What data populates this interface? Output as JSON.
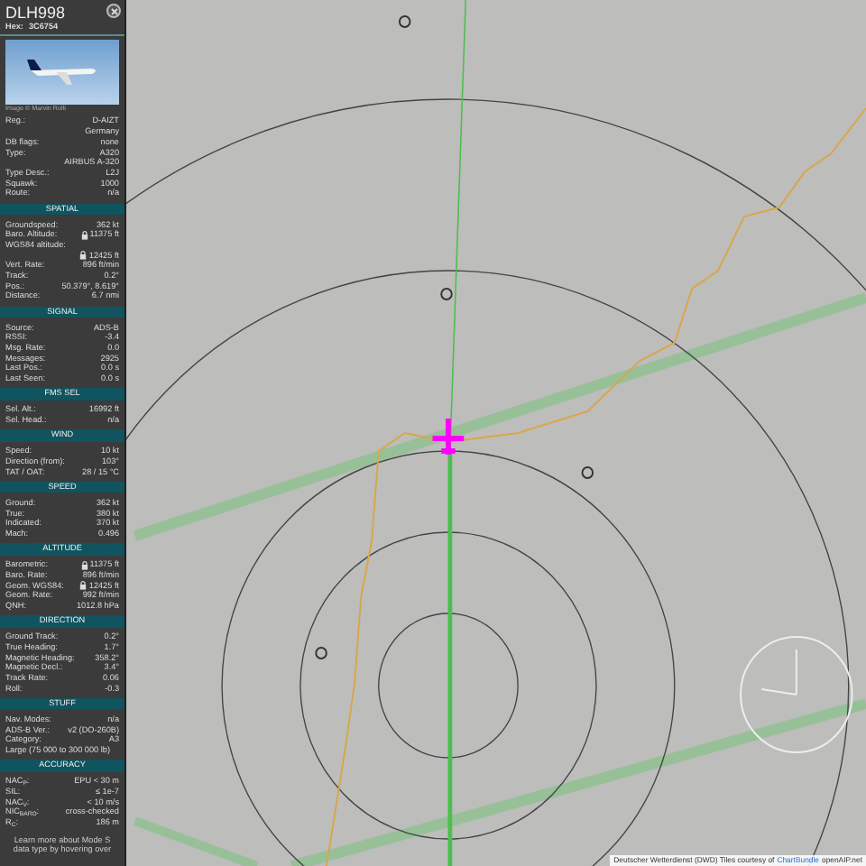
{
  "aircraft": {
    "callsign": "DLH998",
    "hex_label": "Hex:",
    "hex": "3C6754"
  },
  "photo": {
    "credit": "Image © Marvin Rolli"
  },
  "details": [
    {
      "kind": "pair",
      "label": "Reg.:",
      "value": "D-AIZT",
      "locked": false
    },
    {
      "kind": "value",
      "value": "Germany",
      "locked": false
    },
    {
      "kind": "pair",
      "label": "DB flags:",
      "value": "none",
      "locked": false
    },
    {
      "kind": "pair",
      "label": "Type:",
      "value": "A320",
      "locked": false
    },
    {
      "kind": "value",
      "value": "AIRBUS A-320",
      "locked": false
    },
    {
      "kind": "pair",
      "label": "Type Desc.:",
      "value": "L2J",
      "locked": false
    },
    {
      "kind": "pair",
      "label": "Squawk:",
      "value": "1000",
      "locked": false
    },
    {
      "kind": "pair",
      "label": "Route:",
      "value": "n/a",
      "locked": false
    }
  ],
  "sections": [
    {
      "title": "SPATIAL",
      "rows": [
        {
          "kind": "pair",
          "label": "Groundspeed:",
          "value": "362 kt",
          "locked": false
        },
        {
          "kind": "pair",
          "label": "Baro. Altitude:",
          "value": "11375 ft",
          "locked": true
        },
        {
          "kind": "note",
          "value": "WGS84 altitude:",
          "locked": false
        },
        {
          "kind": "value",
          "value": "12425 ft",
          "locked": true
        },
        {
          "kind": "pair",
          "label": "Vert. Rate:",
          "value": "896 ft/min",
          "locked": false
        },
        {
          "kind": "pair",
          "label": "Track:",
          "value": "0.2°",
          "locked": false
        },
        {
          "kind": "pair",
          "label": "Pos.:",
          "value": "50.379°, 8.619°",
          "locked": false
        },
        {
          "kind": "pair",
          "label": "Distance:",
          "value": "6.7 nmi",
          "locked": false
        }
      ]
    },
    {
      "title": "SIGNAL",
      "rows": [
        {
          "kind": "pair",
          "label": "Source:",
          "value": "ADS-B",
          "locked": false
        },
        {
          "kind": "pair",
          "label": "RSSI:",
          "value": "-3.4",
          "locked": false
        },
        {
          "kind": "pair",
          "label": "Msg. Rate:",
          "value": "0.0",
          "locked": false
        },
        {
          "kind": "pair",
          "label": "Messages:",
          "value": "2925",
          "locked": false
        },
        {
          "kind": "pair",
          "label": "Last Pos.:",
          "value": "0.0 s",
          "locked": false
        },
        {
          "kind": "pair",
          "label": "Last Seen:",
          "value": "0.0 s",
          "locked": false
        }
      ]
    },
    {
      "title": "FMS SEL",
      "rows": [
        {
          "kind": "pair",
          "label": "Sel. Alt.:",
          "value": "16992 ft",
          "locked": false
        },
        {
          "kind": "pair",
          "label": "Sel. Head.:",
          "value": "n/a",
          "locked": false
        }
      ]
    },
    {
      "title": "WIND",
      "rows": [
        {
          "kind": "pair",
          "label": "Speed:",
          "value": "10 kt",
          "locked": false
        },
        {
          "kind": "pair",
          "label": "Direction (from):",
          "value": "103°",
          "locked": false
        },
        {
          "kind": "pair",
          "label": "TAT / OAT:",
          "value": "28 / 15 °C",
          "locked": false
        }
      ]
    },
    {
      "title": "SPEED",
      "rows": [
        {
          "kind": "pair",
          "label": "Ground:",
          "value": "362 kt",
          "locked": false
        },
        {
          "kind": "pair",
          "label": "True:",
          "value": "380 kt",
          "locked": false
        },
        {
          "kind": "pair",
          "label": "Indicated:",
          "value": "370 kt",
          "locked": false
        },
        {
          "kind": "pair",
          "label": "Mach:",
          "value": "0.496",
          "locked": false
        }
      ]
    },
    {
      "title": "ALTITUDE",
      "rows": [
        {
          "kind": "pair",
          "label": "Barometric:",
          "value": "11375 ft",
          "locked": true
        },
        {
          "kind": "pair",
          "label": "Baro. Rate:",
          "value": "896 ft/min",
          "locked": false
        },
        {
          "kind": "pair",
          "label": "Geom. WGS84:",
          "value": "12425 ft",
          "locked": true
        },
        {
          "kind": "pair",
          "label": "Geom. Rate:",
          "value": "992 ft/min",
          "locked": false
        },
        {
          "kind": "pair",
          "label": "QNH:",
          "value": "1012.8 hPa",
          "locked": false
        }
      ]
    },
    {
      "title": "DIRECTION",
      "rows": [
        {
          "kind": "pair",
          "label": "Ground Track:",
          "value": "0.2°",
          "locked": false
        },
        {
          "kind": "pair",
          "label": "True Heading:",
          "value": "1.7°",
          "locked": false
        },
        {
          "kind": "pair",
          "label": "Magnetic Heading:",
          "value": "358.2°",
          "locked": false
        },
        {
          "kind": "pair",
          "label": "Magnetic Decl.:",
          "value": "3.4°",
          "locked": false
        },
        {
          "kind": "pair",
          "label": "Track Rate:",
          "value": "0.06",
          "locked": false
        },
        {
          "kind": "pair",
          "label": "Roll:",
          "value": "-0.3",
          "locked": false
        }
      ]
    },
    {
      "title": "STUFF",
      "rows": [
        {
          "kind": "pair",
          "label": "Nav. Modes:",
          "value": "n/a",
          "locked": false
        },
        {
          "kind": "pair",
          "label": "ADS-B Ver.:",
          "value": "v2 (DO-260B)",
          "locked": false
        },
        {
          "kind": "pair",
          "label": "Category:",
          "value": "A3",
          "locked": false
        },
        {
          "kind": "note",
          "value": "Large (75 000 to 300 000 lb)",
          "locked": false
        }
      ]
    },
    {
      "title": "ACCURACY",
      "rows": [
        {
          "kind": "pair",
          "label": "NAC$_{P}$:",
          "value": "EPU < 30 m",
          "locked": false
        },
        {
          "kind": "pair",
          "label": "SIL:",
          "value": "≤ 1e-7",
          "locked": false
        },
        {
          "kind": "pair",
          "label": "NAC$_{V}$:",
          "value": "< 10 m/s",
          "locked": false
        },
        {
          "kind": "pair",
          "label": "NIC$_{BARO}$:",
          "value": "cross-checked",
          "locked": false
        },
        {
          "kind": "pair",
          "label": "R$_{C}$:",
          "value": "186 m",
          "locked": false
        }
      ]
    }
  ],
  "footer": "Learn more about Mode S data type by hovering over",
  "attribution": {
    "text": "Deutscher Wetterdienst (DWD) Tiles courtesy of",
    "link": "ChartBundle",
    "suffix": "openAIP.net"
  }
}
